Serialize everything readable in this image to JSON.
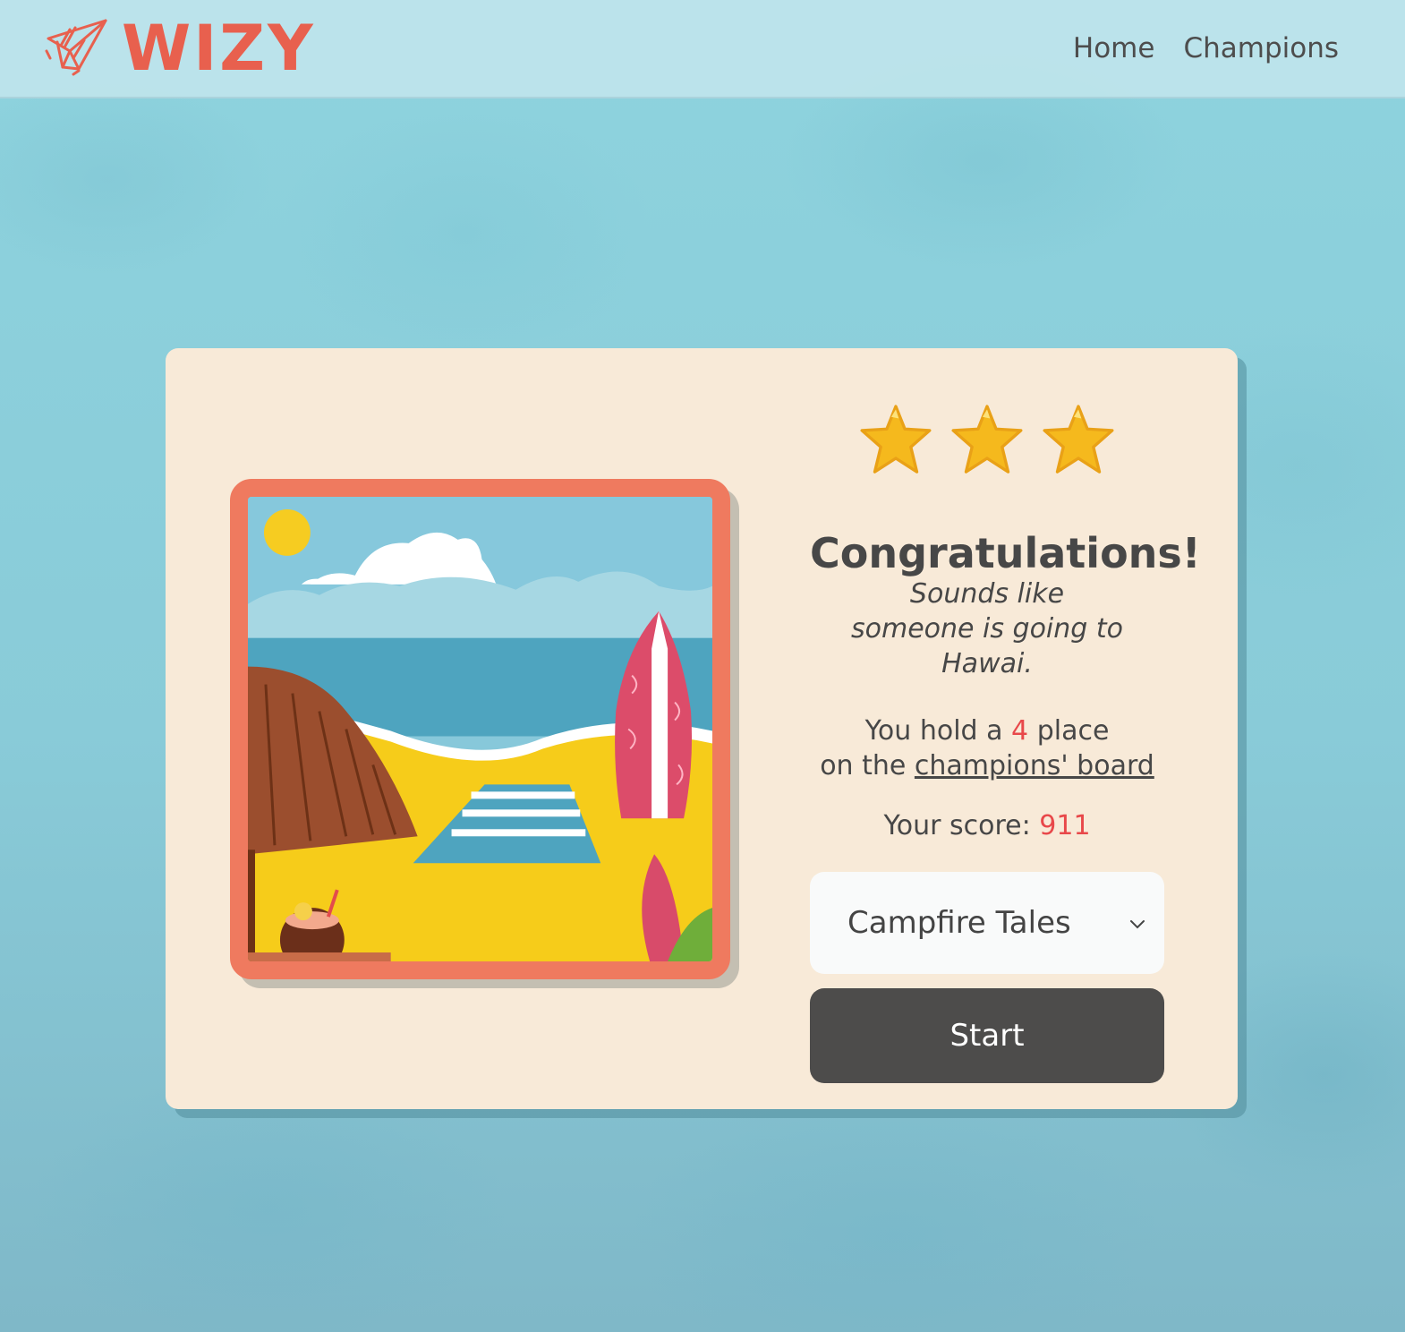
{
  "header": {
    "brand": "WIZY",
    "nav": [
      {
        "label": "Home"
      },
      {
        "label": "Champions"
      }
    ]
  },
  "result": {
    "stars_filled": 3,
    "stars_total": 3,
    "title": "Congratulations!",
    "subtitle_line1": "Sounds like",
    "subtitle_line2": "someone is going to Hawai.",
    "place_prefix": "You hold a",
    "place_value": "4",
    "place_suffix": "place",
    "place_line2_prefix": "on the",
    "place_link": "champions' board",
    "score_label": "Your score:",
    "score_value": "911"
  },
  "quiz_select": {
    "selected": "Campfire Tales"
  },
  "start_button": {
    "label": "Start"
  },
  "colors": {
    "brand": "#e8604e",
    "accent": "#e8484a",
    "card": "#f8ead8",
    "frame": "#ef7a5f",
    "button": "#4d4c4b"
  }
}
